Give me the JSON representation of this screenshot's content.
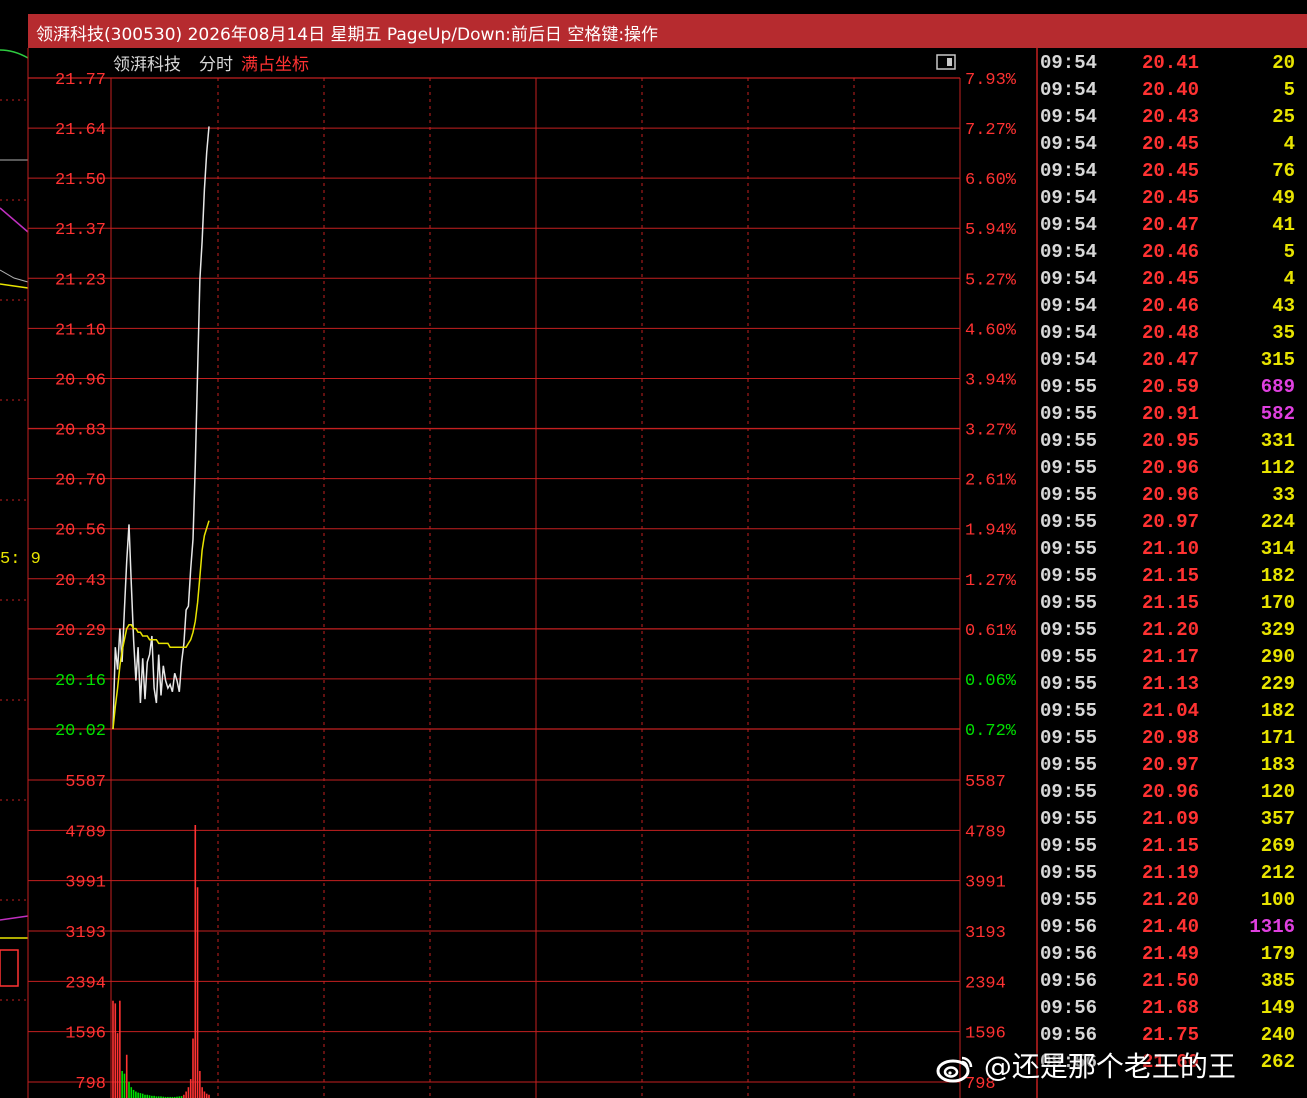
{
  "window": {
    "title": "领湃科技(300530) 2026年08月14日 星期五 PageUp/Down:前后日 空格键:操作"
  },
  "chart_header": {
    "stock_name": "领湃科技",
    "mode": "分时",
    "option": "满占坐标"
  },
  "left_strip": {
    "partial_text": "5: 9"
  },
  "colors": {
    "grid": "#c42020",
    "price_line": "#e8e8e8",
    "avg_line": "#e8e400",
    "up": "#ff3232",
    "down": "#00e000",
    "volume_big": "#e040e0",
    "volume_normal": "#e8e400",
    "time": "#d8d8d8"
  },
  "chart_data": {
    "type": "line",
    "title": "领湃科技 分时",
    "price_axis": {
      "ticks": [
        "21.77",
        "21.64",
        "21.50",
        "21.37",
        "21.23",
        "21.10",
        "20.96",
        "20.83",
        "20.70",
        "20.56",
        "20.43",
        "20.29",
        "20.16",
        "20.02"
      ],
      "tick_values": [
        21.77,
        21.64,
        21.5,
        21.37,
        21.23,
        21.1,
        20.96,
        20.83,
        20.7,
        20.56,
        20.43,
        20.29,
        20.16,
        20.02
      ],
      "tick_colors": [
        "up",
        "up",
        "up",
        "up",
        "up",
        "up",
        "up",
        "up",
        "up",
        "up",
        "up",
        "up",
        "down",
        "down"
      ],
      "ylim": [
        20.02,
        21.77
      ]
    },
    "pct_axis": {
      "ticks": [
        "7.93%",
        "7.27%",
        "6.60%",
        "5.94%",
        "5.27%",
        "4.60%",
        "3.94%",
        "3.27%",
        "2.61%",
        "1.94%",
        "1.27%",
        "0.61%",
        "0.06%",
        "0.72%"
      ],
      "tick_colors": [
        "up",
        "up",
        "up",
        "up",
        "up",
        "up",
        "up",
        "up",
        "up",
        "up",
        "up",
        "up",
        "down",
        "down"
      ]
    },
    "volume_axis": {
      "ticks": [
        "5587",
        "4789",
        "3991",
        "3193",
        "2394",
        "1596",
        "798"
      ],
      "tick_values": [
        5587,
        4789,
        3991,
        3193,
        2394,
        1596,
        798
      ],
      "ylim": [
        0,
        5587
      ]
    },
    "series": [
      {
        "name": "price",
        "values": [
          20.02,
          20.24,
          20.18,
          20.29,
          20.2,
          20.34,
          20.47,
          20.57,
          20.41,
          20.26,
          20.15,
          20.24,
          20.09,
          20.21,
          20.1,
          20.2,
          20.22,
          20.27,
          20.13,
          20.09,
          20.22,
          20.11,
          20.19,
          20.15,
          20.13,
          20.14,
          20.12,
          20.17,
          20.15,
          20.12,
          20.2,
          20.25,
          20.34,
          20.35,
          20.45,
          20.53,
          20.73,
          20.98,
          21.23,
          21.33,
          21.47,
          21.57,
          21.64
        ]
      },
      {
        "name": "avg",
        "values": [
          20.02,
          20.08,
          20.13,
          20.19,
          20.23,
          20.26,
          20.29,
          20.3,
          20.3,
          20.29,
          20.29,
          20.28,
          20.28,
          20.27,
          20.27,
          20.27,
          20.26,
          20.26,
          20.26,
          20.26,
          20.25,
          20.25,
          20.25,
          20.25,
          20.25,
          20.24,
          20.24,
          20.24,
          20.24,
          20.24,
          20.24,
          20.24,
          20.24,
          20.25,
          20.26,
          20.28,
          20.31,
          20.36,
          20.43,
          20.5,
          20.54,
          20.56,
          20.58
        ]
      }
    ],
    "volume": [
      1800,
      1750,
      1200,
      1800,
      500,
      450,
      800,
      300,
      200,
      150,
      120,
      100,
      90,
      80,
      60,
      60,
      50,
      40,
      40,
      30,
      30,
      30,
      25,
      20,
      20,
      20,
      20,
      20,
      25,
      30,
      35,
      60,
      120,
      200,
      350,
      1100,
      5050,
      3900,
      500,
      200,
      120,
      80,
      60
    ],
    "volume_up": [
      true,
      true,
      true,
      true,
      false,
      false,
      true,
      false,
      false,
      false,
      false,
      false,
      false,
      false,
      false,
      false,
      false,
      false,
      false,
      false,
      false,
      false,
      false,
      false,
      false,
      false,
      false,
      false,
      false,
      false,
      false,
      true,
      true,
      true,
      true,
      true,
      true,
      true,
      true,
      true,
      true,
      true,
      true
    ]
  },
  "ticks_panel": {
    "rows": [
      {
        "time": "09:54",
        "price": "20.41",
        "vol": "20",
        "big": false
      },
      {
        "time": "09:54",
        "price": "20.40",
        "vol": "5",
        "big": false
      },
      {
        "time": "09:54",
        "price": "20.43",
        "vol": "25",
        "big": false
      },
      {
        "time": "09:54",
        "price": "20.45",
        "vol": "4",
        "big": false
      },
      {
        "time": "09:54",
        "price": "20.45",
        "vol": "76",
        "big": false
      },
      {
        "time": "09:54",
        "price": "20.45",
        "vol": "49",
        "big": false
      },
      {
        "time": "09:54",
        "price": "20.47",
        "vol": "41",
        "big": false
      },
      {
        "time": "09:54",
        "price": "20.46",
        "vol": "5",
        "big": false
      },
      {
        "time": "09:54",
        "price": "20.45",
        "vol": "4",
        "big": false
      },
      {
        "time": "09:54",
        "price": "20.46",
        "vol": "43",
        "big": false
      },
      {
        "time": "09:54",
        "price": "20.48",
        "vol": "35",
        "big": false
      },
      {
        "time": "09:54",
        "price": "20.47",
        "vol": "315",
        "big": false
      },
      {
        "time": "09:55",
        "price": "20.59",
        "vol": "689",
        "big": true
      },
      {
        "time": "09:55",
        "price": "20.91",
        "vol": "582",
        "big": true
      },
      {
        "time": "09:55",
        "price": "20.95",
        "vol": "331",
        "big": false
      },
      {
        "time": "09:55",
        "price": "20.96",
        "vol": "112",
        "big": false
      },
      {
        "time": "09:55",
        "price": "20.96",
        "vol": "33",
        "big": false
      },
      {
        "time": "09:55",
        "price": "20.97",
        "vol": "224",
        "big": false
      },
      {
        "time": "09:55",
        "price": "21.10",
        "vol": "314",
        "big": false
      },
      {
        "time": "09:55",
        "price": "21.15",
        "vol": "182",
        "big": false
      },
      {
        "time": "09:55",
        "price": "21.15",
        "vol": "170",
        "big": false
      },
      {
        "time": "09:55",
        "price": "21.20",
        "vol": "329",
        "big": false
      },
      {
        "time": "09:55",
        "price": "21.17",
        "vol": "290",
        "big": false
      },
      {
        "time": "09:55",
        "price": "21.13",
        "vol": "229",
        "big": false
      },
      {
        "time": "09:55",
        "price": "21.04",
        "vol": "182",
        "big": false
      },
      {
        "time": "09:55",
        "price": "20.98",
        "vol": "171",
        "big": false
      },
      {
        "time": "09:55",
        "price": "20.97",
        "vol": "183",
        "big": false
      },
      {
        "time": "09:55",
        "price": "20.96",
        "vol": "120",
        "big": false
      },
      {
        "time": "09:55",
        "price": "21.09",
        "vol": "357",
        "big": false
      },
      {
        "time": "09:55",
        "price": "21.15",
        "vol": "269",
        "big": false
      },
      {
        "time": "09:55",
        "price": "21.19",
        "vol": "212",
        "big": false
      },
      {
        "time": "09:55",
        "price": "21.20",
        "vol": "100",
        "big": false
      },
      {
        "time": "09:56",
        "price": "21.40",
        "vol": "1316",
        "big": true
      },
      {
        "time": "09:56",
        "price": "21.49",
        "vol": "179",
        "big": false
      },
      {
        "time": "09:56",
        "price": "21.50",
        "vol": "385",
        "big": false
      },
      {
        "time": "09:56",
        "price": "21.68",
        "vol": "149",
        "big": false
      },
      {
        "time": "09:56",
        "price": "21.75",
        "vol": "240",
        "big": false
      },
      {
        "time": "09:56",
        "price": "21.60",
        "vol": "262",
        "big": false
      }
    ]
  },
  "watermark": {
    "text": "@还是那个老王的王"
  }
}
